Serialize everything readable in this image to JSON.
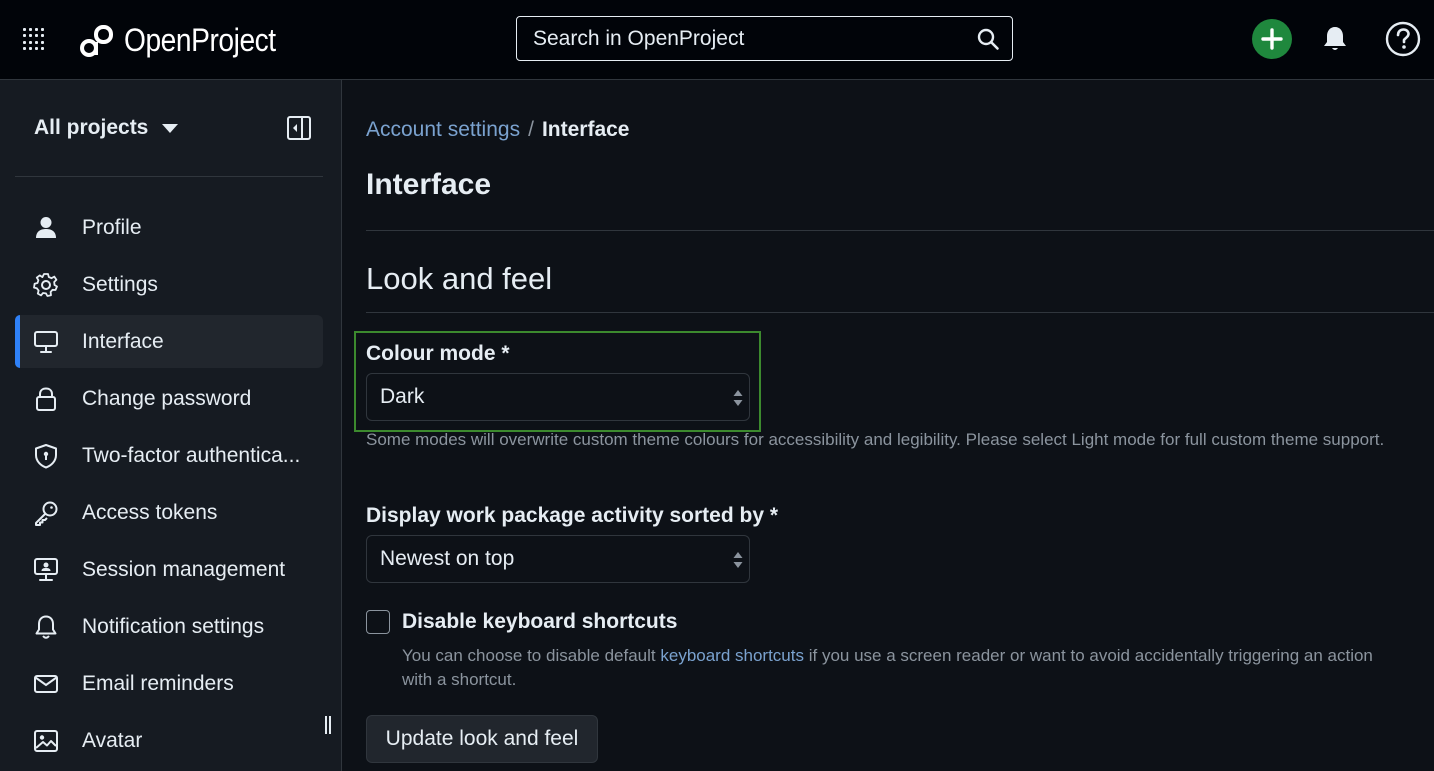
{
  "header": {
    "app_name": "OpenProject",
    "search_placeholder": "Search in OpenProject"
  },
  "sidebar": {
    "project_selector": "All projects",
    "items": [
      {
        "label": "Profile",
        "icon": "person-icon",
        "active": false
      },
      {
        "label": "Settings",
        "icon": "gear-icon",
        "active": false
      },
      {
        "label": "Interface",
        "icon": "monitor-icon",
        "active": true
      },
      {
        "label": "Change password",
        "icon": "lock-icon",
        "active": false
      },
      {
        "label": "Two-factor authentica...",
        "icon": "shield-icon",
        "active": false
      },
      {
        "label": "Access tokens",
        "icon": "key-icon",
        "active": false
      },
      {
        "label": "Session management",
        "icon": "session-monitor-icon",
        "active": false
      },
      {
        "label": "Notification settings",
        "icon": "bell-icon",
        "active": false
      },
      {
        "label": "Email reminders",
        "icon": "mail-icon",
        "active": false
      },
      {
        "label": "Avatar",
        "icon": "image-icon",
        "active": false
      }
    ]
  },
  "breadcrumb": {
    "parent": "Account settings",
    "separator": "/",
    "current": "Interface"
  },
  "page": {
    "title": "Interface",
    "section_title": "Look and feel"
  },
  "form": {
    "colour_mode": {
      "label": "Colour mode *",
      "value": "Dark",
      "help": "Some modes will overwrite custom theme colours for accessibility and legibility. Please select Light mode for full custom theme support."
    },
    "activity_sort": {
      "label": "Display work package activity sorted by *",
      "value": "Newest on top"
    },
    "keyboard_shortcuts": {
      "label": "Disable keyboard shortcuts",
      "checked": false,
      "help_before": "You can choose to disable default ",
      "help_link": "keyboard shortcuts",
      "help_after": " if you use a screen reader or want to avoid accidentally triggering an action with a shortcut."
    },
    "submit_label": "Update look and feel"
  },
  "colors": {
    "accent": "#2f81f7",
    "create_button": "#1f883d",
    "highlight_border": "#3c8a2e"
  }
}
